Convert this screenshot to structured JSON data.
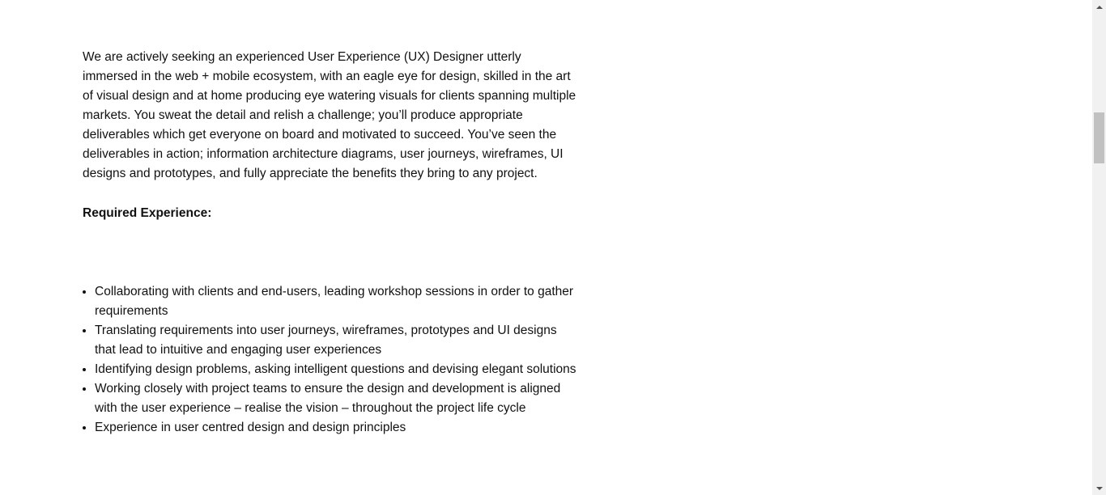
{
  "job_description": {
    "intro": "We are actively seeking an experienced User Experience (UX) Designer utterly immersed in the web + mobile ecosystem, with an eagle eye for design, skilled in the art of visual design and at home producing eye watering visuals for clients spanning multiple markets.  You sweat the detail and relish a challenge; you’ll produce appropriate deliverables which get everyone on board and motivated to succeed. You’ve seen the deliverables in action; information architecture diagrams, user journeys, wireframes, UI designs and prototypes, and fully appreciate the benefits they bring to any project.",
    "required_heading": "Required Experience:",
    "requirements": [
      "Collaborating with clients and end-users, leading workshop sessions in order to gather requirements",
      "Translating requirements into user journeys, wireframes, prototypes and UI designs that lead to intuitive and engaging user experiences",
      "Identifying design problems, asking intelligent questions and devising elegant solutions",
      "Working closely with project teams to ensure the design and development is aligned with the user experience – realise the vision – throughout the project life cycle",
      "Experience in user centred design and design principles"
    ]
  },
  "scrollbar": {
    "icons": {
      "up": "scroll-up-arrow-icon",
      "down": "scroll-down-arrow-icon"
    }
  }
}
